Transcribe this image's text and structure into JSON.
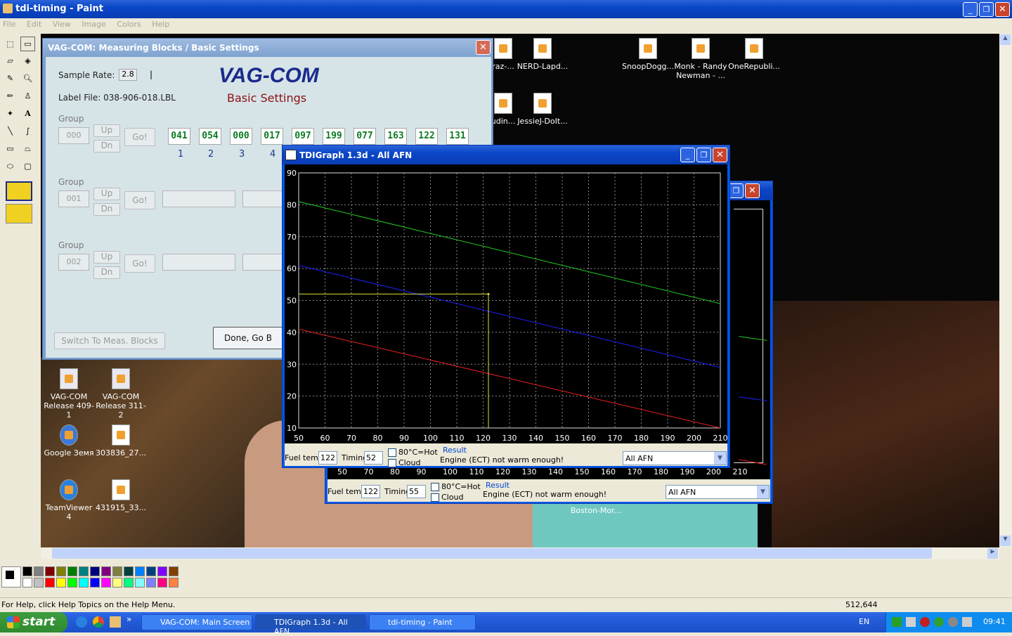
{
  "paint": {
    "title": "tdi-timing - Paint",
    "menu": [
      "File",
      "Edit",
      "View",
      "Image",
      "Colors",
      "Help"
    ],
    "status_help": "For Help, click Help Topics on the Help Menu.",
    "status_coords": "512,644"
  },
  "desktop_icons": [
    {
      "label": "raz-...",
      "x": "left"
    },
    {
      "label": "NERD-Lapd..."
    },
    {
      "label": "SnoopDogg..."
    },
    {
      "label": "Monk - Randy Newman - ..."
    },
    {
      "label": "OneRepubli..."
    },
    {
      "label": "udin..."
    },
    {
      "label": "JessieJ-DoIt..."
    },
    {
      "label": "VAG-COM Release 409-1"
    },
    {
      "label": "VAG-COM Release 311-2"
    },
    {
      "label": "Google Земя"
    },
    {
      "label": "303836_27..."
    },
    {
      "label": "TeamViewer 4"
    },
    {
      "label": "431915_33..."
    },
    {
      "label": "Boston-Mor..."
    }
  ],
  "vag": {
    "title": "VAG-COM: Measuring Blocks / Basic Settings",
    "sample_rate_label": "Sample Rate:",
    "sample_rate": "2.8",
    "sample_bar": "|",
    "logo": "VAG-COM",
    "subtitle": "Basic Settings",
    "label_file": "Label File:  038-906-018.LBL",
    "group_label": "Group",
    "groups": [
      "000",
      "001",
      "002"
    ],
    "up": "Up",
    "dn": "Dn",
    "go": "Go!",
    "values": [
      "041",
      "054",
      "000",
      "017",
      "097",
      "199",
      "077",
      "163",
      "122",
      "131"
    ],
    "value_indices": [
      "1",
      "2",
      "3",
      "4"
    ],
    "switch_btn": "Switch To Meas. Blocks",
    "done_btn": "Done, Go B"
  },
  "tdi_front": {
    "title": "TDIGraph 1.3d - All AFN",
    "fuel_temp_label": "Fuel temp",
    "fuel_temp": "122",
    "timing_label": "Timing",
    "timing": "52",
    "hot_label": "80°C=Hot",
    "cloud_label": "Cloud",
    "result_label": "Result",
    "result_text": "Engine (ECT) not warm enough!",
    "select": "All AFN"
  },
  "tdi_back": {
    "fuel_temp_label": "Fuel temp",
    "fuel_temp": "122",
    "timing_label": "Timing",
    "timing": "55",
    "hot_label": "80°C=Hot",
    "cloud_label": "Cloud",
    "result_label": "Result",
    "result_text": "Engine (ECT) not warm enough!",
    "select": "All AFN",
    "x_ticks": [
      "50",
      "70",
      "80",
      "90",
      "100",
      "110",
      "120",
      "130",
      "140",
      "150",
      "160",
      "170",
      "180",
      "190",
      "200",
      "210"
    ]
  },
  "chart_data": {
    "type": "line",
    "x": [
      50,
      210
    ],
    "xlim": [
      50,
      210
    ],
    "ylim": [
      10,
      90
    ],
    "x_ticks": [
      50,
      60,
      70,
      80,
      90,
      100,
      110,
      120,
      130,
      140,
      150,
      160,
      170,
      180,
      190,
      200,
      210
    ],
    "y_ticks": [
      10,
      20,
      30,
      40,
      50,
      60,
      70,
      80,
      90
    ],
    "grid": true,
    "series": [
      {
        "color": "#22cc22",
        "values": [
          81,
          49
        ]
      },
      {
        "color": "#2020ff",
        "values": [
          61,
          29
        ]
      },
      {
        "color": "#ee2020",
        "values": [
          41,
          10
        ]
      }
    ],
    "marker": {
      "color": "#e0e040",
      "x": 122,
      "y": 52
    }
  },
  "taskbar": {
    "start": "start",
    "tasks": [
      "VAG-COM: Main Screen",
      "TDIGraph 1.3d - All AFN",
      "tdi-timing - Paint"
    ],
    "lang": "EN",
    "clock": "09:41"
  },
  "colors": {
    "xp_blue": "#0a46c8",
    "vag_green": "#0a7a22",
    "vag_logo": "#1a2a8c",
    "vag_sub": "#8b1010"
  }
}
